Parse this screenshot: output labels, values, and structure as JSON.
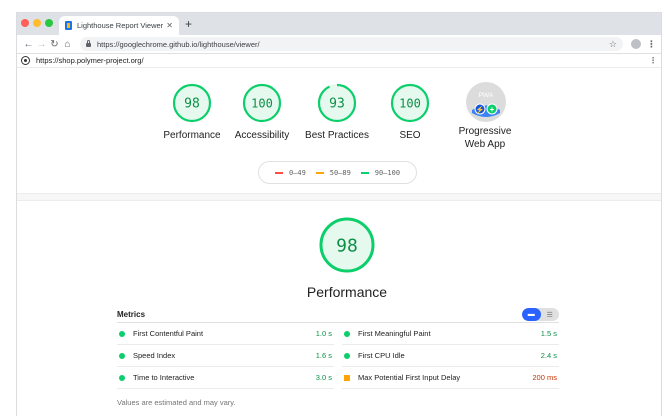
{
  "browser": {
    "tab_title": "Lighthouse Report Viewer",
    "tab_close": "✕",
    "new_tab": "+",
    "url": "https://googlechrome.github.io/lighthouse/viewer/"
  },
  "report": {
    "url": "https://shop.polymer-project.org/"
  },
  "gauges": [
    {
      "label": "Performance",
      "score": 98,
      "color": "#0cce6b"
    },
    {
      "label": "Accessibility",
      "score": 100,
      "color": "#0cce6b"
    },
    {
      "label": "Best Practices",
      "score": 93,
      "color": "#0cce6b"
    },
    {
      "label": "SEO",
      "score": 100,
      "color": "#0cce6b"
    }
  ],
  "pwa": {
    "label_line1": "Progressive",
    "label_line2": "Web App",
    "badge_text": "PWA"
  },
  "legend": [
    {
      "range": "0–49",
      "status": "fail",
      "color": "#ff4e42"
    },
    {
      "range": "50–89",
      "status": "average",
      "color": "#ffa400"
    },
    {
      "range": "90–100",
      "status": "pass",
      "color": "#0cce6b"
    }
  ],
  "performance": {
    "score": 98,
    "title": "Performance"
  },
  "metrics": {
    "title": "Metrics",
    "items": [
      {
        "name": "First Contentful Paint",
        "value": "1.0 s",
        "status": "pass"
      },
      {
        "name": "First Meaningful Paint",
        "value": "1.5 s",
        "status": "pass"
      },
      {
        "name": "Speed Index",
        "value": "1.6 s",
        "status": "pass"
      },
      {
        "name": "First CPU Idle",
        "value": "2.4 s",
        "status": "pass"
      },
      {
        "name": "Time to Interactive",
        "value": "3.0 s",
        "status": "pass"
      },
      {
        "name": "Max Potential First Input Delay",
        "value": "200 ms",
        "status": "average"
      }
    ],
    "note": "Values are estimated and may vary."
  }
}
